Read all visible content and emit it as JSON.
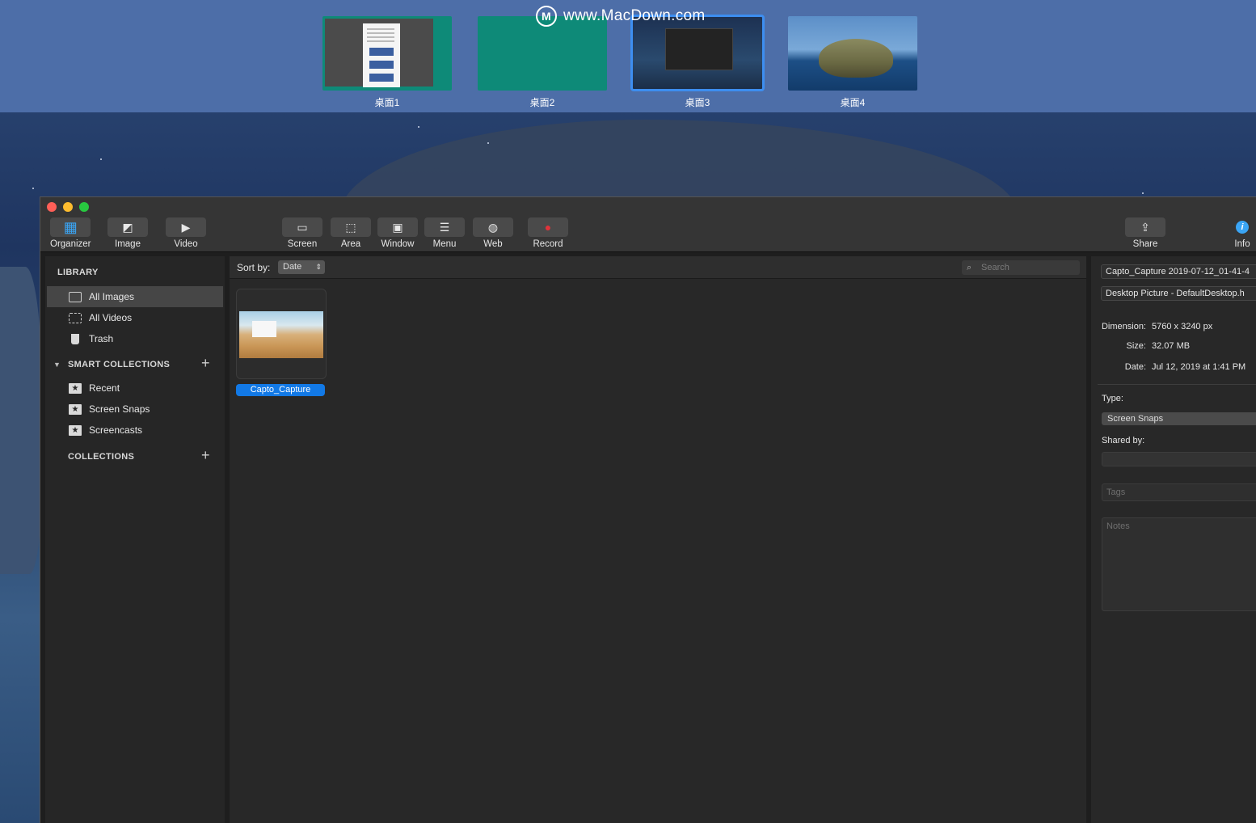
{
  "watermark": {
    "logo": "M",
    "text": "www.MacDown.com"
  },
  "desktops": [
    {
      "label": "桌面1"
    },
    {
      "label": "桌面2"
    },
    {
      "label": "桌面3"
    },
    {
      "label": "桌面4"
    }
  ],
  "toolbar": {
    "left": [
      {
        "label": "Organizer",
        "icon": "grid-icon",
        "glyph": "▦"
      },
      {
        "label": "Image",
        "icon": "image-icon",
        "glyph": "◩"
      },
      {
        "label": "Video",
        "icon": "video-camera-icon",
        "glyph": "▶"
      }
    ],
    "capture": [
      {
        "label": "Screen",
        "icon": "screen-capture-icon",
        "glyph": "▭"
      },
      {
        "label": "Area",
        "icon": "area-capture-icon",
        "glyph": "⬚"
      },
      {
        "label": "Window",
        "icon": "window-capture-icon",
        "glyph": "▣"
      },
      {
        "label": "Menu",
        "icon": "menu-capture-icon",
        "glyph": "☰"
      },
      {
        "label": "Web",
        "icon": "web-capture-icon",
        "glyph": "◍"
      },
      {
        "label": "Record",
        "icon": "record-icon",
        "glyph": "●"
      }
    ],
    "share": {
      "label": "Share",
      "icon": "share-icon",
      "glyph": "⇪"
    },
    "info": {
      "label": "Info",
      "icon": "info-icon",
      "glyph": "i"
    }
  },
  "sidebar": {
    "library_title": "LIBRARY",
    "library": [
      {
        "label": "All Images",
        "icon": "image-icon",
        "selected": true
      },
      {
        "label": "All Videos",
        "icon": "film-icon",
        "selected": false
      },
      {
        "label": "Trash",
        "icon": "trash-icon",
        "selected": false
      }
    ],
    "smart_title": "SMART COLLECTIONS",
    "smart": [
      {
        "label": "Recent",
        "icon": "star-folder-icon"
      },
      {
        "label": "Screen Snaps",
        "icon": "star-folder-icon"
      },
      {
        "label": "Screencasts",
        "icon": "star-folder-icon"
      }
    ],
    "collections_title": "COLLECTIONS",
    "add_glyph": "+"
  },
  "main": {
    "sort_label": "Sort by:",
    "sort_value": "Date",
    "search_placeholder": "Search",
    "items": [
      {
        "label": "Capto_Capture"
      }
    ]
  },
  "info": {
    "filename": "Capto_Capture 2019-07-12_01-41-4",
    "source": "Desktop Picture - DefaultDesktop.h",
    "dimension_label": "Dimension:",
    "dimension_value": "5760 x 3240 px",
    "size_label": "Size:",
    "size_value": "32.07 MB",
    "date_label": "Date:",
    "date_value": "Jul 12, 2019 at 1:41 PM",
    "type_label": "Type:",
    "type_value": "Screen Snaps",
    "shared_label": "Shared by:",
    "tags_placeholder": "Tags",
    "notes_placeholder": "Notes"
  },
  "colors": {
    "accent": "#1279e6",
    "close": "#ff5f57",
    "minimize": "#febc2e",
    "maximize": "#28c840",
    "record_red": "#e0333a",
    "info_blue": "#3aa5f5"
  }
}
